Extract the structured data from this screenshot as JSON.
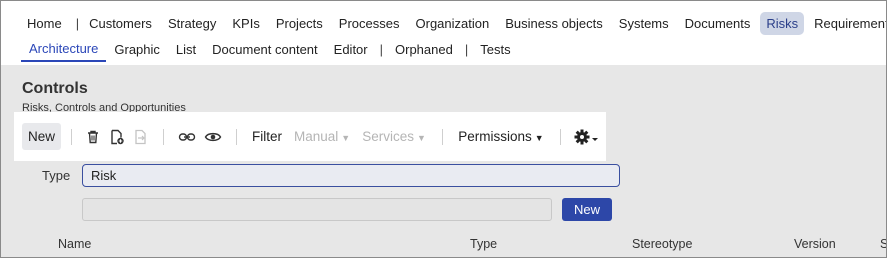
{
  "nav_primary": [
    "Home",
    "Customers",
    "Strategy",
    "KPIs",
    "Projects",
    "Processes",
    "Organization",
    "Business objects",
    "Systems",
    "Documents",
    "Risks",
    "Requirements"
  ],
  "nav_secondary": [
    "Architecture",
    "Graphic",
    "List",
    "Document content",
    "Editor",
    "Orphaned",
    "Tests"
  ],
  "page": {
    "title": "Controls",
    "subtitle": "Risks, Controls and Opportunities"
  },
  "toolbar": {
    "new_label": "New",
    "filter_label": "Filter",
    "manual_label": "Manual",
    "services_label": "Services",
    "permissions_label": "Permissions",
    "icons": [
      "trash-icon",
      "document-add-icon",
      "document-export-icon",
      "link-icon",
      "eye-icon",
      "gear-icon"
    ]
  },
  "form": {
    "type_label": "Type",
    "type_value": "Risk",
    "search_value": "",
    "new_button_label": "New"
  },
  "table": {
    "columns": [
      "Name",
      "Type",
      "Stereotype",
      "Version",
      "S"
    ]
  },
  "colors": {
    "accent": "#2d47a8",
    "active_tab_bg": "#cfd6e6"
  }
}
